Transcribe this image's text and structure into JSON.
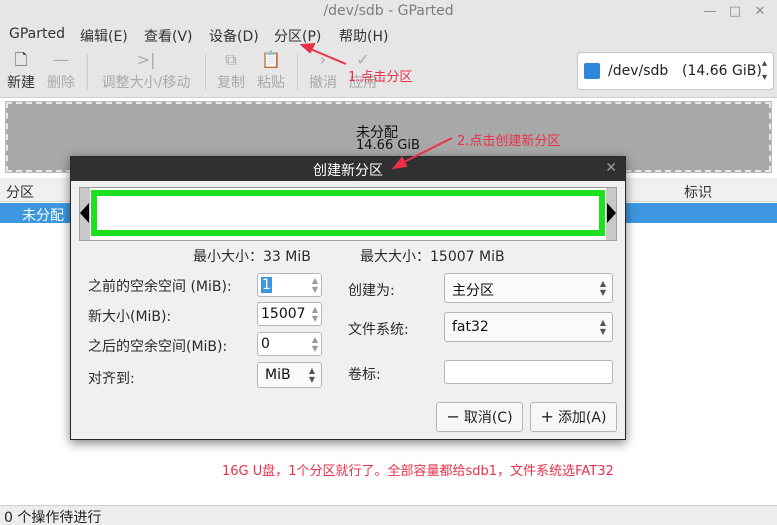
{
  "window": {
    "title": "/dev/sdb - GParted"
  },
  "menu": [
    "GParted",
    "编辑(E)",
    "查看(V)",
    "设备(D)",
    "分区(P)",
    "帮助(H)"
  ],
  "toolbar": {
    "new": "新建",
    "delete": "删除",
    "resize": "调整大小/移动",
    "copy": "复制",
    "paste": "粘贴",
    "undo": "撤消",
    "apply": "应用"
  },
  "device": {
    "name": "/dev/sdb",
    "size": "(14.66 GiB)",
    "icon": "disk-icon"
  },
  "visual": {
    "label": "未分配",
    "size": "14.66 GiB"
  },
  "list": {
    "columns": {
      "partition": "分区",
      "flags": "标识"
    },
    "rows": [
      {
        "partition": "未分配"
      }
    ]
  },
  "annotations": {
    "step1": "1.点击分区",
    "step2": "2.点击创建新分区",
    "note": "16G U盘，1个分区就行了。全部容量都给sdb1，文件系统选FAT32",
    "color": "#e8304a"
  },
  "dialog": {
    "title": "创建新分区",
    "min_size": "最小大小：33 MiB",
    "max_size": "最大大小：15007 MiB",
    "free_before_label": "之前的空余空间 (MiB):",
    "free_before_value": "1",
    "new_size_label": "新大小(MiB):",
    "new_size_value": "15007",
    "free_after_label": "之后的空余空间(MiB):",
    "free_after_value": "0",
    "align_label": "对齐到:",
    "align_value": "MiB",
    "create_as_label": "创建为:",
    "create_as_value": "主分区",
    "fs_label": "文件系统:",
    "fs_value": "fat32",
    "volume_label": "卷标:",
    "volume_value": "",
    "cancel": "取消(C)",
    "add": "添加(A)",
    "highlight_color": "#1ee01e"
  },
  "status": {
    "pending": "0 个操作待进行"
  }
}
